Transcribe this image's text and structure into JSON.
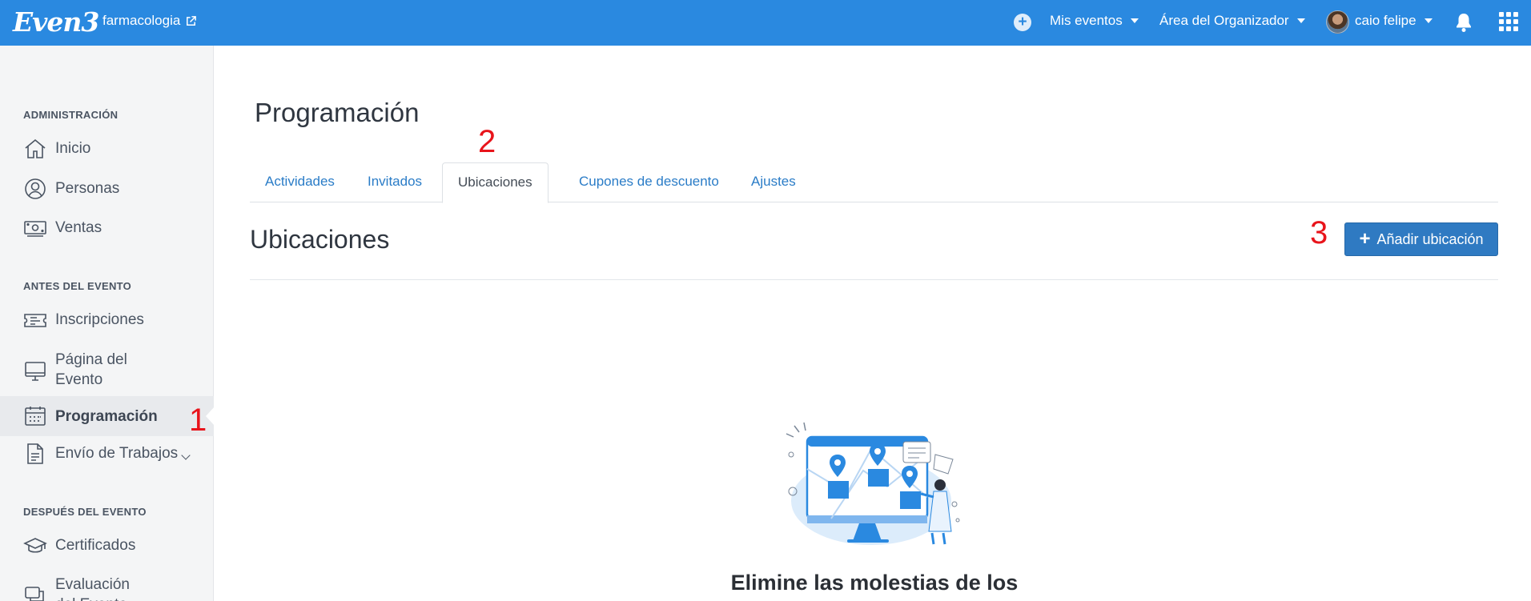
{
  "topbar": {
    "logo": "Even3",
    "event_name": "farmacologia",
    "mis_eventos": "Mis eventos",
    "area_organizador": "Área del Organizador",
    "user_name": "caio felipe"
  },
  "sidebar": {
    "sections": [
      {
        "title": "ADMINISTRACIÓN"
      },
      {
        "title": "ANTES DEL EVENTO"
      },
      {
        "title": "DESPUÉS DEL EVENTO"
      }
    ],
    "items": [
      {
        "label": "Inicio",
        "icon": "home-icon"
      },
      {
        "label": "Personas",
        "icon": "user-circle-icon"
      },
      {
        "label": "Ventas",
        "icon": "money-icon"
      },
      {
        "label": "Inscripciones",
        "icon": "ticket-icon"
      },
      {
        "label": "Página del Evento",
        "icon": "monitor-icon"
      },
      {
        "label": "Programación",
        "icon": "calendar-icon",
        "active": true
      },
      {
        "label": "Envío de Trabajos",
        "icon": "document-icon"
      },
      {
        "label": "Certificados",
        "icon": "graduation-cap-icon"
      },
      {
        "label": "Evaluación del Evento",
        "icon": "chat-icon"
      }
    ]
  },
  "annotations": {
    "one": "1",
    "two": "2",
    "three": "3"
  },
  "main": {
    "page_title": "Programación",
    "tabs": [
      {
        "label": "Actividades"
      },
      {
        "label": "Invitados"
      },
      {
        "label": "Ubicaciones",
        "active": true
      },
      {
        "label": "Cupones de descuento"
      },
      {
        "label": "Ajustes"
      }
    ],
    "section_title": "Ubicaciones",
    "add_button": "Añadir ubicación",
    "empty_title": "Elimine las molestias de los lugares de eventos"
  },
  "colors": {
    "topbar": "#2a89e0",
    "button": "#2f7ac2",
    "link": "#2a7cc7",
    "annotation": "#e8141b"
  }
}
